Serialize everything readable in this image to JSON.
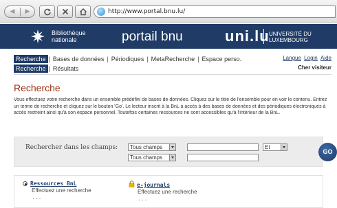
{
  "browser": {
    "url": "http://www.portal.bnu.lu/"
  },
  "banner": {
    "library_line1": "Bibliothèque",
    "library_line2": "nationale",
    "portal_title": "portail bnu",
    "uni_mark": "uni.lu",
    "university_line1": "UNIVERSITÉ DU",
    "university_line2": "LUXEMBOURG"
  },
  "nav": {
    "primary": [
      "Recherche",
      "Bases de données",
      "Périodiques",
      "MetaRecherche",
      "Espace perso."
    ],
    "secondary": [
      "Recherche",
      "Résultats"
    ],
    "utility": [
      "Langue",
      "Login",
      "Aide"
    ],
    "visitor": "Cher visiteur"
  },
  "page": {
    "title": "Recherche",
    "intro": "Vous effectuez votre recherche dans un ensemble prédéfini de bases de données. Cliquez sur le titre de l'ensemble pour en voir le contenu. Entrez un terme de recherche et cliquez sur le bouton 'Go'. Le lecteur inscrit à la BnL a accès à des bases de données et des périodiques électroniques à accès restreint ainsi qu'à son espace personnel. Toutefois certaines ressources ne sont accessibles qu'à l'intérieur de la BnL."
  },
  "search": {
    "label": "Rechercher dans les champs:",
    "field1": "Tous champs",
    "field2": "Tous champs",
    "operator": "Et",
    "go": "GO"
  },
  "resources": [
    {
      "title": "Ressources BnL",
      "subtitle": "Effectuez une recherche",
      "more": "..."
    },
    {
      "title": "e-journals",
      "subtitle": "Effectuez une recherche",
      "more": "..."
    }
  ],
  "colors": {
    "banner": "#1f3b66",
    "title": "#9b2d0e"
  }
}
